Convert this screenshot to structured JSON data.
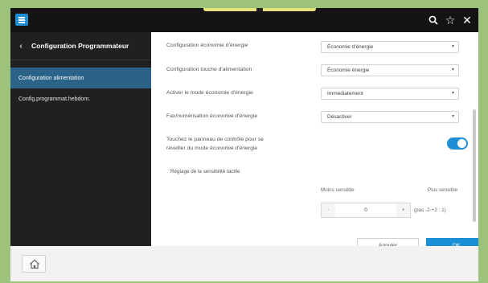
{
  "topbar": {
    "icons": [
      "menu-icon",
      "search-icon",
      "star-icon",
      "close-icon"
    ],
    "accent": "#1e8fd6"
  },
  "sidebar": {
    "title": "Configuration Programmateur",
    "items": [
      {
        "label": "Configuration alimentation",
        "active": true
      },
      {
        "label": "Config.programmat.hebdom.",
        "active": false
      }
    ]
  },
  "settings": [
    {
      "label": "Configuration économie d'énergie",
      "value": "Économie d'énergie"
    },
    {
      "label": "Configuration touche d'alimentation",
      "value": "Économie énergie"
    },
    {
      "label": "Activer le mode économie d'énergie",
      "value": "Immédiatement"
    },
    {
      "label": "Fax/numérisation économie d'énergie",
      "value": "Désactiver"
    }
  ],
  "wake": {
    "line1": "Touchez le panneau de contrôle pour se",
    "line2": "réveiller du mode économie d'énergie",
    "enabled": true
  },
  "sensitivity": {
    "title": "Réglage de la sensibilité tactile",
    "low_label": "Moins sensible",
    "high_label": "Plus sensible",
    "value": "0",
    "minus": "-",
    "plus": "+",
    "range_note": "(pas -2-+2 : 1)"
  },
  "actions": {
    "cancel": "Annuler",
    "ok": "OK"
  }
}
